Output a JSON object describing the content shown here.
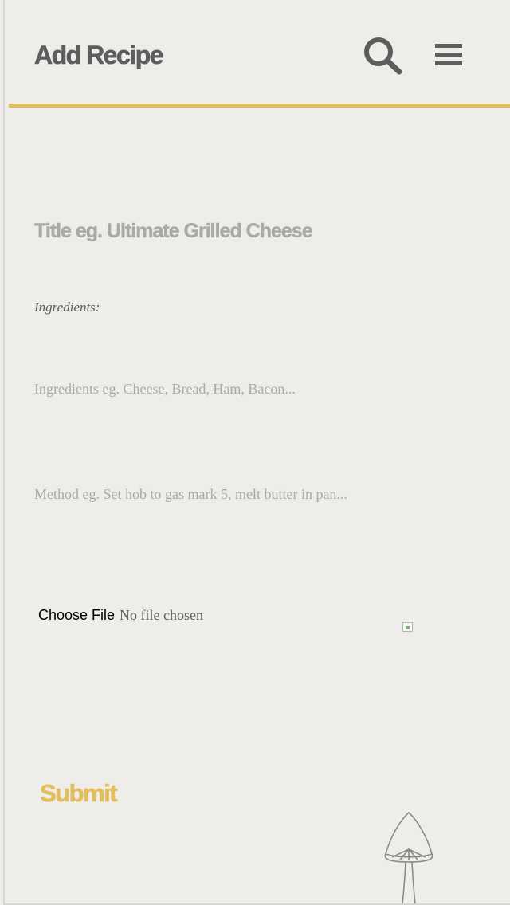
{
  "header": {
    "title": "Add Recipe",
    "search_icon": "search-icon",
    "menu_icon": "hamburger-menu-icon"
  },
  "form": {
    "title_placeholder": "Title eg. Ultimate Grilled Cheese",
    "ingredients_label": "Ingredients:",
    "ingredients_placeholder": "Ingredients eg. Cheese, Bread, Ham, Bacon...",
    "method_placeholder": "Method eg. Set hob to gas mark 5, melt butter in pan...",
    "file_button_label": "Choose File",
    "file_status": "No file chosen",
    "preview_icon": "broken-image-icon",
    "submit_label": "Submit"
  },
  "decoration": {
    "mushroom_icon": "mushroom-icon"
  },
  "colors": {
    "accent": "#e3be5c",
    "text": "#5d5d5d",
    "placeholder": "#a9a9a7",
    "background": "#eeede9"
  }
}
